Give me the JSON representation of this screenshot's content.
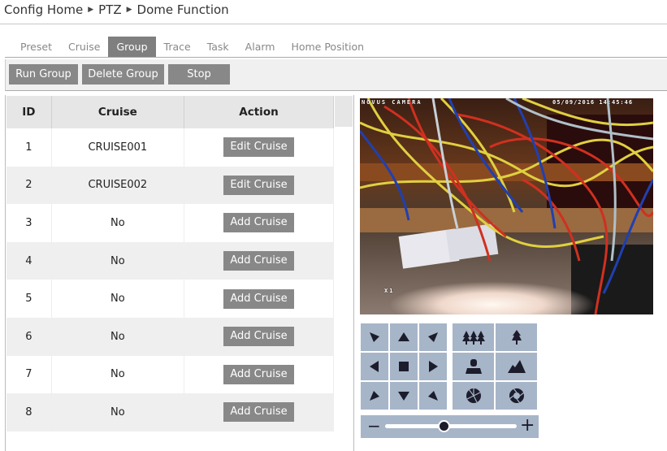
{
  "breadcrumb": {
    "items": [
      "Config Home",
      "PTZ",
      "Dome Function"
    ],
    "separator": "▶"
  },
  "tabs": [
    {
      "label": "Preset",
      "active": false
    },
    {
      "label": "Cruise",
      "active": false
    },
    {
      "label": "Group",
      "active": true
    },
    {
      "label": "Trace",
      "active": false
    },
    {
      "label": "Task",
      "active": false
    },
    {
      "label": "Alarm",
      "active": false
    },
    {
      "label": "Home Position",
      "active": false
    }
  ],
  "toolbar": {
    "run_group": "Run Group",
    "delete_group": "Delete Group",
    "stop": "Stop"
  },
  "table": {
    "headers": [
      "ID",
      "Cruise",
      "Action"
    ],
    "rows": [
      {
        "id": "1",
        "cruise": "CRUISE001",
        "action": "Edit Cruise"
      },
      {
        "id": "2",
        "cruise": "CRUISE002",
        "action": "Edit Cruise"
      },
      {
        "id": "3",
        "cruise": "No",
        "action": "Add Cruise"
      },
      {
        "id": "4",
        "cruise": "No",
        "action": "Add Cruise"
      },
      {
        "id": "5",
        "cruise": "No",
        "action": "Add Cruise"
      },
      {
        "id": "6",
        "cruise": "No",
        "action": "Add Cruise"
      },
      {
        "id": "7",
        "cruise": "No",
        "action": "Add Cruise"
      },
      {
        "id": "8",
        "cruise": "No",
        "action": "Add Cruise"
      }
    ]
  },
  "video": {
    "osd_title": "NOVUS CAMERA",
    "osd_datetime": "05/09/2016 14:45:46",
    "osd_zoom": "X1"
  },
  "ptz": {
    "direction_icons": [
      "arrow-up-left-icon",
      "arrow-up-icon",
      "arrow-up-right-icon",
      "arrow-left-icon",
      "stop-icon",
      "arrow-right-icon",
      "arrow-down-left-icon",
      "arrow-down-icon",
      "arrow-down-right-icon"
    ],
    "lens_icons": [
      "zoom-out-trees-icon",
      "zoom-in-tree-icon",
      "focus-near-person-icon",
      "focus-far-mountain-icon",
      "iris-close-icon",
      "iris-open-icon"
    ],
    "zoom_slider": {
      "minus": "−",
      "plus": "+",
      "value_fraction": 0.45
    }
  },
  "colors": {
    "button_gray": "#888888",
    "ptz_blue": "#a7b5c8",
    "icon_dark": "#1c1c2c"
  }
}
